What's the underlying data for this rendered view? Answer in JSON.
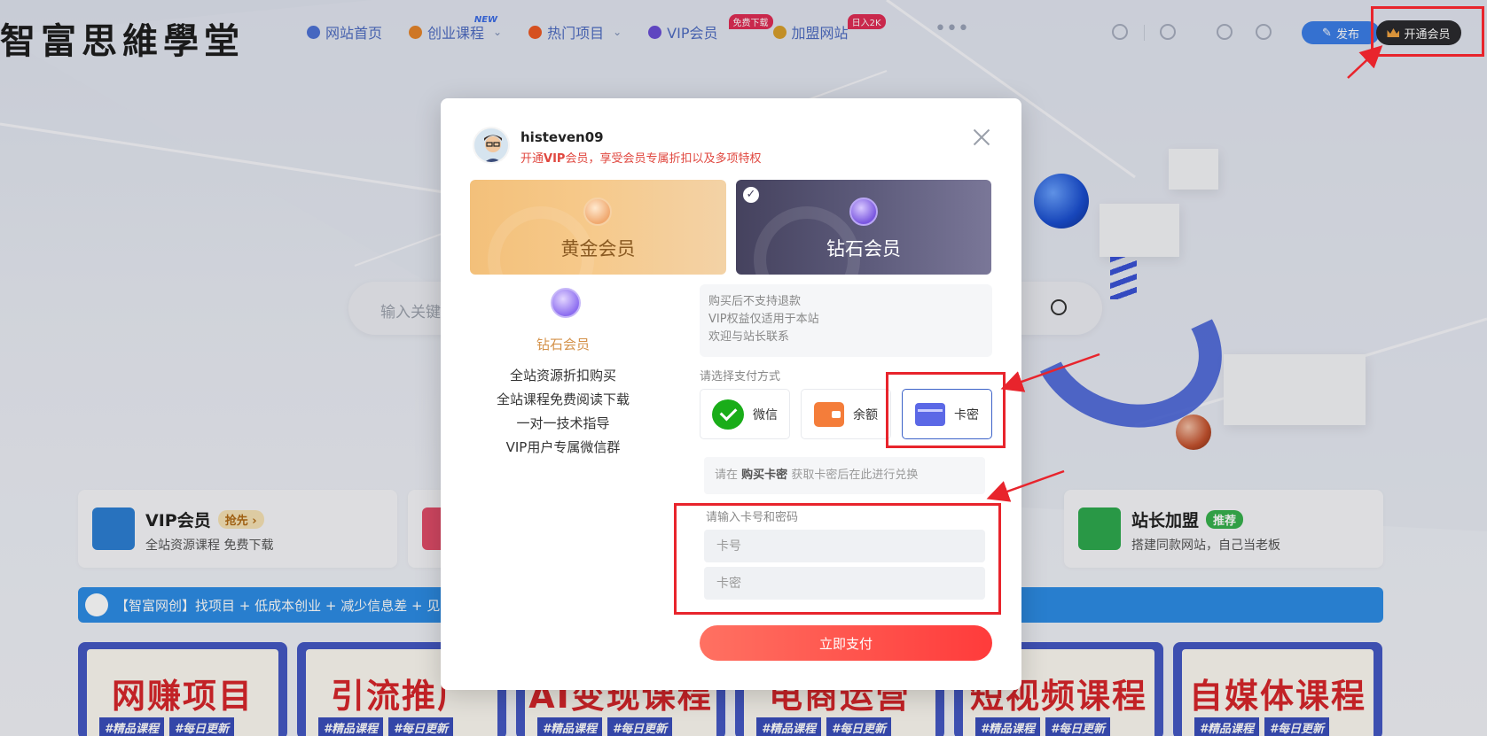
{
  "site": {
    "logo_text": "智富思維學堂",
    "nav": [
      {
        "label": "网站首页",
        "badge": "",
        "icon": "home-icon",
        "color": "#4f73d6"
      },
      {
        "label": "创业课程",
        "badge": "NEW",
        "icon": "grid-icon",
        "color": "#e6852b"
      },
      {
        "label": "热门项目",
        "badge": "",
        "icon": "fire-icon",
        "color": "#ee5a24"
      },
      {
        "label": "VIP会员",
        "badge": "免费下载",
        "icon": "vip-icon",
        "color": "#6a4fd6"
      },
      {
        "label": "加盟网站",
        "badge": "日入2K",
        "icon": "tag-icon",
        "color": "#d8a02c"
      }
    ],
    "nav_more": "•••",
    "publish_label": "发布",
    "vip_open_label": "开通会员",
    "search_placeholder": "输入关键"
  },
  "features": [
    {
      "title": "VIP会员",
      "tag": "抢先 ›",
      "sub": "全站资源课程 免费下载",
      "icon_color": "#2d7fd4",
      "tag_bg": "#f6e3b5",
      "tag_color": "#b16a15"
    },
    {
      "title": "站长加盟",
      "tag": "推荐",
      "sub": "搭建同款网站，自己当老板",
      "icon_color": "#2eaa4e",
      "tag_bg": "#37b24d",
      "tag_color": "#ffffff"
    }
  ],
  "notice": {
    "text": "【智富网创】找项目 + 低成本创业 + 减少信息差 + 见识"
  },
  "courses": [
    {
      "title": "网赚项目",
      "tags": [
        "#精品课程",
        "#每日更新"
      ]
    },
    {
      "title": "引流推广",
      "tags": [
        "#精品课程",
        "#每日更新"
      ]
    },
    {
      "title": "AI变现课程",
      "tags": [
        "#精品课程",
        "#每日更新"
      ]
    },
    {
      "title": "电商运营",
      "tags": [
        "#精品课程",
        "#每日更新"
      ]
    },
    {
      "title": "短视频课程",
      "tags": [
        "#精品课程",
        "#每日更新"
      ]
    },
    {
      "title": "自媒体课程",
      "tags": [
        "#精品课程",
        "#每日更新"
      ]
    }
  ],
  "modal": {
    "username": "histeven09",
    "subtitle_prefix": "开通",
    "subtitle_vip": "VIP",
    "subtitle_suffix": "会员，享受会员专属折扣以及多项特权",
    "tiers": [
      {
        "label": "黄金会员",
        "selected": false
      },
      {
        "label": "钻石会员",
        "selected": true
      }
    ],
    "benefit_name": "钻石会员",
    "benefits": [
      "全站资源折扣购买",
      "全站课程免费阅读下载",
      "一对一技术指导",
      "VIP用户专属微信群"
    ],
    "notes": [
      "购买后不支持退款",
      "VIP权益仅适用于本站",
      "欢迎与站长联系"
    ],
    "pay_method_label": "请选择支付方式",
    "pay_options": [
      {
        "label": "微信",
        "icon": "wechat-icon",
        "active": false
      },
      {
        "label": "余额",
        "icon": "wallet-icon",
        "active": false
      },
      {
        "label": "卡密",
        "icon": "card-icon",
        "active": true
      }
    ],
    "redeem_prefix": "请在",
    "redeem_link": "购买卡密",
    "redeem_suffix": "获取卡密后在此进行兑换",
    "card_input_label": "请输入卡号和密码",
    "card_number_placeholder": "卡号",
    "card_password_placeholder": "卡密",
    "pay_button": "立即支付"
  },
  "colors": {
    "annotation": "#e8242c",
    "pay_button": "#ff4a45",
    "primary_blue": "#3b7ee8"
  }
}
